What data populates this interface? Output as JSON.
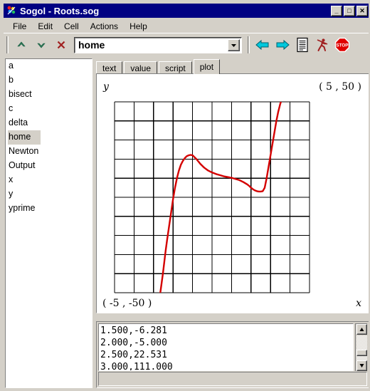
{
  "window": {
    "title": "Sogol - Roots.sog",
    "icon": "app-icon",
    "buttons": {
      "minimize": "_",
      "maximize": "□",
      "close": "✕"
    }
  },
  "menubar": {
    "items": [
      "File",
      "Edit",
      "Cell",
      "Actions",
      "Help"
    ]
  },
  "toolbar": {
    "buttons": [
      {
        "name": "move-up-button",
        "icon": "chevron-up-icon",
        "glyph": "▲",
        "color": "#2e7d5b"
      },
      {
        "name": "move-down-button",
        "icon": "chevron-down-icon",
        "glyph": "▼",
        "color": "#2e7d5b"
      },
      {
        "name": "delete-button",
        "icon": "x-icon",
        "glyph": "✕",
        "color": "#a02020"
      }
    ],
    "cell_selector": {
      "value": "home",
      "placeholder": "",
      "arrow_icon": "chevron-down-icon"
    },
    "right_buttons": [
      {
        "name": "back-button",
        "icon": "arrow-left-icon",
        "color": "#00b7c8"
      },
      {
        "name": "forward-button",
        "icon": "arrow-right-icon",
        "color": "#00b7c8"
      },
      {
        "name": "list-button",
        "icon": "document-icon",
        "color": "#000000"
      },
      {
        "name": "run-button",
        "icon": "runner-icon",
        "color": "#a02020"
      },
      {
        "name": "stop-button",
        "icon": "stop-sign-icon",
        "color": "#e00000"
      }
    ]
  },
  "sidebar": {
    "items": [
      "a",
      "b",
      "bisect",
      "c",
      "delta",
      "home",
      "Newton",
      "Output",
      "x",
      "y",
      "yprime"
    ],
    "selected": "home"
  },
  "tabs": {
    "items": [
      "text",
      "value",
      "script",
      "plot"
    ],
    "active": "plot"
  },
  "plot": {
    "y_axis_label": "y",
    "x_axis_label": "x",
    "max_corner_label": "( 5 , 50 )",
    "min_corner_label": "( -5 , -50 )",
    "curve_color": "#d40000",
    "grid_color": "#000000"
  },
  "chart_data": {
    "type": "line",
    "title": "",
    "xlabel": "x",
    "ylabel": "y",
    "xlim": [
      -5,
      5
    ],
    "ylim": [
      -50,
      50
    ],
    "grid": true,
    "grid_divisions": 10,
    "legend": "none",
    "annotations": [
      "( 5 , 50 )",
      "( -5 , -50 )"
    ],
    "series": [
      {
        "name": "y",
        "color": "#d40000",
        "x": [
          -2.68,
          -2.6,
          -2.52,
          -2.45,
          -2.38,
          -2.3,
          -2.2,
          -2.1,
          -2.0,
          -1.9,
          -1.8,
          -1.7,
          -1.6,
          -1.5,
          -1.4,
          -1.3,
          -1.2,
          -1.1,
          -1.0,
          -0.8,
          -0.6,
          -0.4,
          -0.2,
          0.0,
          0.2,
          0.4,
          0.6,
          0.8,
          1.0,
          1.2,
          1.4,
          1.6,
          1.8,
          1.9,
          2.0,
          2.1,
          2.2,
          2.3,
          2.4,
          2.5,
          2.6,
          2.7,
          2.8,
          2.9,
          3.0,
          3.1,
          3.2,
          3.3,
          3.4,
          3.5,
          3.6,
          3.7,
          3.75
        ],
        "y": [
          -52.0,
          -46.0,
          -40.0,
          -34.0,
          -28.0,
          -22.0,
          -15.0,
          -8.0,
          -1.0,
          5.0,
          10.0,
          14.0,
          17.0,
          19.0,
          20.5,
          21.5,
          22.0,
          22.2,
          22.0,
          20.0,
          17.5,
          15.5,
          14.0,
          13.0,
          12.2,
          11.6,
          11.0,
          10.6,
          10.2,
          9.6,
          9.0,
          8.0,
          6.8,
          6.0,
          5.0,
          4.2,
          3.6,
          3.2,
          3.0,
          3.0,
          3.2,
          5.0,
          10.0,
          16.0,
          22.0,
          28.0,
          34.0,
          40.0,
          45.0,
          49.0,
          52.0,
          55.0,
          56.0
        ]
      }
    ]
  },
  "output": {
    "lines": [
      "1.500,-6.281",
      "2.000,-5.000",
      "2.500,22.531",
      "3.000,111.000"
    ],
    "scroll_up_icon": "triangle-up-icon",
    "scroll_down_icon": "triangle-down-icon"
  }
}
